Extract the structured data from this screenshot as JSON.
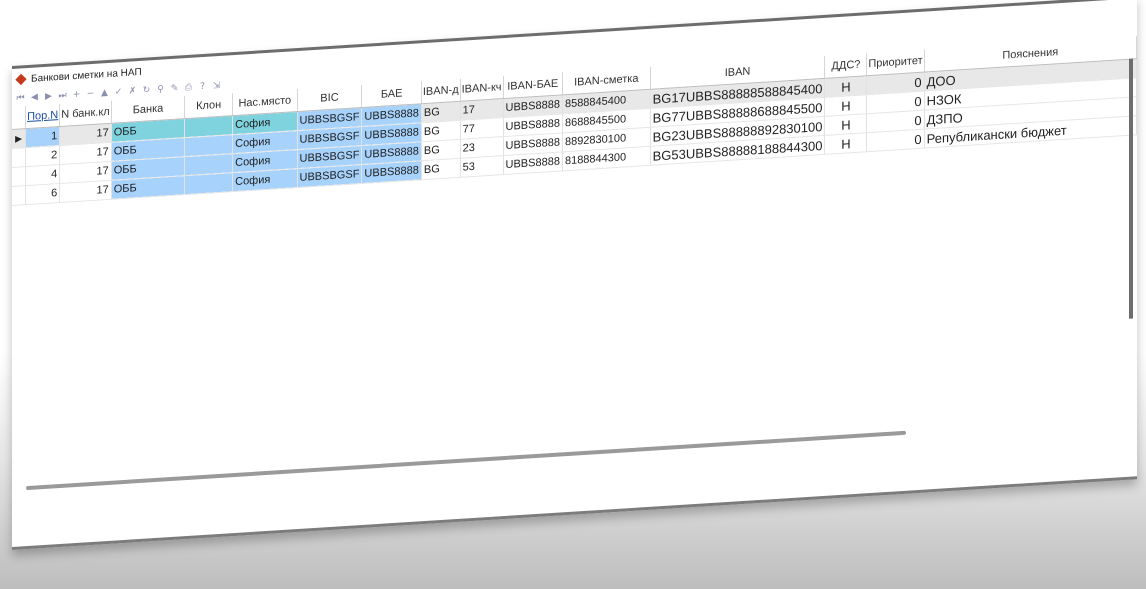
{
  "window": {
    "title": "Банкови сметки на НАП",
    "controls": [
      "—",
      "□",
      "✕"
    ]
  },
  "toolbar": {
    "icons": [
      "first-icon",
      "prev-icon",
      "next-icon",
      "last-icon",
      "insert-icon",
      "delete-icon",
      "edit-icon",
      "post-icon",
      "cancel-icon",
      "refresh-icon",
      "filter-icon",
      "tool-icon",
      "print-icon",
      "help-icon",
      "export-icon"
    ]
  },
  "table": {
    "columns": [
      "Пор.N",
      "N банк.кл",
      "Банка",
      "Клон",
      "Нас.място",
      "BIC",
      "БАЕ",
      "IBAN-д",
      "IBAN-кч",
      "IBAN-БАЕ",
      "IBAN-сметка",
      "IBAN",
      "ДДС?",
      "Приоритет",
      "Пояснения"
    ],
    "rows": [
      {
        "n": "1",
        "bank_code": "17",
        "bank": "ОББ",
        "branch": "",
        "place": "София",
        "bic": "UBBSBGSF",
        "bae": "UBBS8888",
        "iban_d": "BG",
        "iban_kch": "17",
        "iban_bae": "UBBS8888",
        "iban_acc": "8588845400",
        "iban": "BG17UBBS88888588845400",
        "vat": "Н",
        "priority": "0",
        "note": "ДОО"
      },
      {
        "n": "2",
        "bank_code": "17",
        "bank": "ОББ",
        "branch": "",
        "place": "София",
        "bic": "UBBSBGSF",
        "bae": "UBBS8888",
        "iban_d": "BG",
        "iban_kch": "77",
        "iban_bae": "UBBS8888",
        "iban_acc": "8688845500",
        "iban": "BG77UBBS88888688845500",
        "vat": "Н",
        "priority": "0",
        "note": "НЗОК"
      },
      {
        "n": "4",
        "bank_code": "17",
        "bank": "ОББ",
        "branch": "",
        "place": "София",
        "bic": "UBBSBGSF",
        "bae": "UBBS8888",
        "iban_d": "BG",
        "iban_kch": "23",
        "iban_bae": "UBBS8888",
        "iban_acc": "8892830100",
        "iban": "BG23UBBS88888892830100",
        "vat": "Н",
        "priority": "0",
        "note": "ДЗПО"
      },
      {
        "n": "6",
        "bank_code": "17",
        "bank": "ОББ",
        "branch": "",
        "place": "София",
        "bic": "UBBSBGSF",
        "bae": "UBBS8888",
        "iban_d": "BG",
        "iban_kch": "53",
        "iban_bae": "UBBS8888",
        "iban_acc": "8188844300",
        "iban": "BG53UBBS88888188844300",
        "vat": "Н",
        "priority": "0",
        "note": "Републикански бюджет"
      }
    ]
  },
  "colors": {
    "selection_blue": "#a6d2fb",
    "current_cell_teal": "#7fd3df",
    "title_icon": "#c43b1f"
  }
}
